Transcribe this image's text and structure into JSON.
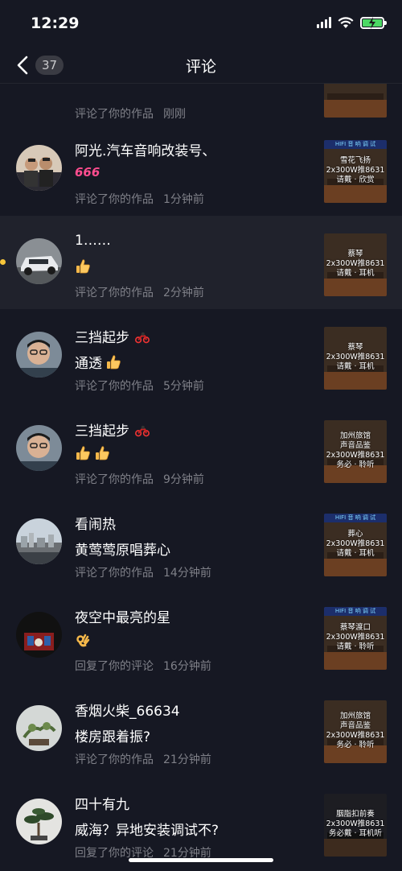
{
  "status_bar": {
    "time": "12:29"
  },
  "nav": {
    "badge_count": "37",
    "title": "评论"
  },
  "partial_item": {
    "action": "评论了你的作品",
    "time": "刚刚"
  },
  "items": [
    {
      "username": "阿光.汽车音响改装号、",
      "content": "",
      "content_emoji": "666",
      "action": "评论了你的作品",
      "time": "1分钟前",
      "thumb": {
        "banner": "HIFI 音 响 调 试",
        "lines": [
          "雪花飞扬",
          "2x300W推8631",
          "请戴 · 欣赏"
        ]
      }
    },
    {
      "username": "1……",
      "content": "",
      "content_emoji": "thumbs-up-icon",
      "action": "评论了你的作品",
      "time": "2分钟前",
      "thumb": {
        "banner": "",
        "lines": [
          "蔡琴",
          "2x300W推8631",
          "请戴 · 耳机"
        ]
      }
    },
    {
      "username": "三挡起步",
      "content": "通透",
      "content_emoji": "thumbs-up-icon",
      "action": "评论了你的作品",
      "time": "5分钟前",
      "thumb": {
        "banner": "",
        "lines": [
          "蔡琴",
          "2x300W推8631",
          "请戴 · 耳机"
        ]
      }
    },
    {
      "username": "三挡起步",
      "content": "",
      "content_emoji": "two-thumbs-up-icon",
      "action": "评论了你的作品",
      "time": "9分钟前",
      "thumb": {
        "banner": "",
        "lines": [
          "加州旅馆",
          "声音品鉴",
          "2x300W推8631",
          "务必 · 聆听"
        ]
      }
    },
    {
      "username": "看闹热",
      "content": "黄莺莺原唱葬心",
      "content_emoji": "",
      "action": "评论了你的作品",
      "time": "14分钟前",
      "thumb": {
        "banner": "HIFI 音 响 调 试",
        "lines": [
          "葬心",
          "2x300W推8631",
          "请戴 · 耳机"
        ]
      }
    },
    {
      "username": "夜空中最亮的星",
      "content": "",
      "content_emoji": "ok-hand-icon",
      "action": "回复了你的评论",
      "time": "16分钟前",
      "thumb": {
        "banner": "HIFI 音 响 调 试",
        "lines": [
          "蔡琴渡口",
          "2x300W推8631",
          "请戴 · 聆听"
        ]
      }
    },
    {
      "username": "香烟火柴_66634",
      "content": "楼房跟着振?",
      "content_emoji": "",
      "action": "评论了你的作品",
      "time": "21分钟前",
      "thumb": {
        "banner": "",
        "lines": [
          "加州旅馆",
          "声音品鉴",
          "2x300W推8631",
          "务必 · 聆听"
        ]
      }
    },
    {
      "username": "四十有九",
      "content": "威海？异地安装调试不?",
      "content_emoji": "",
      "action": "回复了你的评论",
      "time": "21分钟前",
      "thumb": {
        "banner": "",
        "lines": [
          "胭脂扣前奏",
          "2x300W推8631",
          "务必戴 · 耳机听"
        ]
      }
    }
  ]
}
